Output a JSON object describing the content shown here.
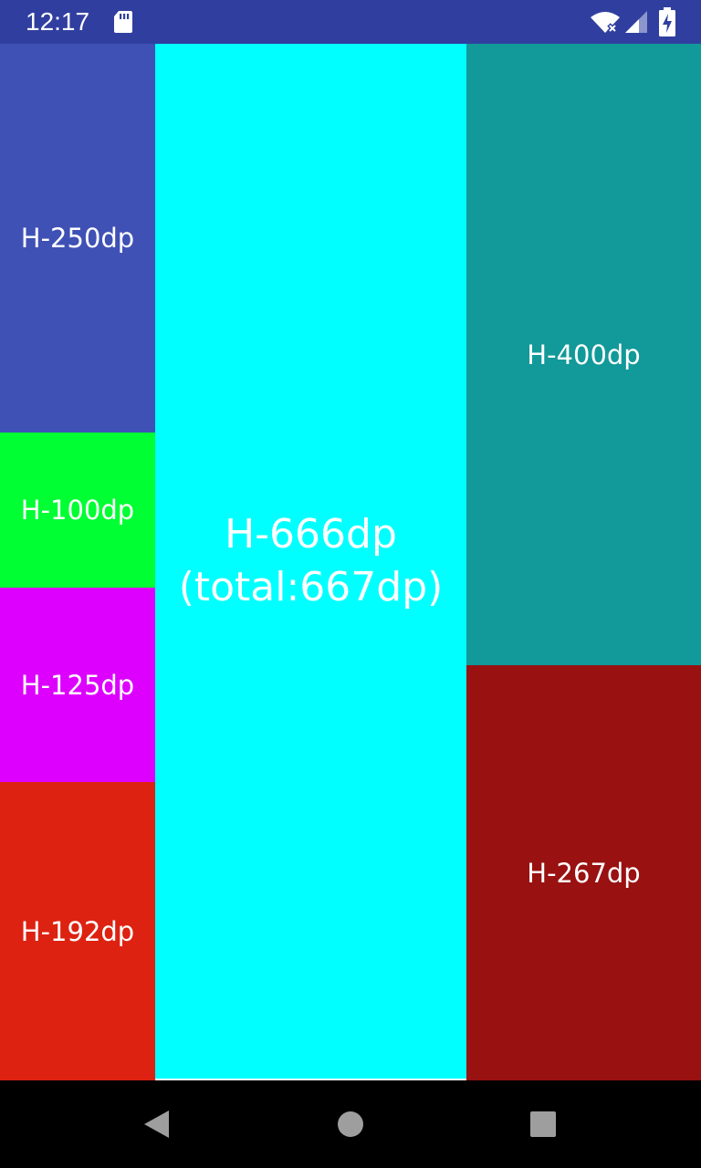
{
  "status_bar": {
    "time": "12:17",
    "background": "#303f9f",
    "icons": [
      "sd-card-icon",
      "wifi-icon",
      "cell-signal-icon",
      "battery-charging-icon"
    ]
  },
  "columns": {
    "left": [
      {
        "label": "H-250dp",
        "color": "#3f51b5"
      },
      {
        "label": "H-100dp",
        "color": "#00ff33"
      },
      {
        "label": "H-125dp",
        "color": "#dd00ff"
      },
      {
        "label": "H-192dp",
        "color": "#dd2211"
      }
    ],
    "center": [
      {
        "label": "H-666dp\n(total:667dp)",
        "color": "#00ffff"
      }
    ],
    "right": [
      {
        "label": "H-400dp",
        "color": "#129999"
      },
      {
        "label": "H-267dp",
        "color": "#991111"
      }
    ]
  },
  "nav_bar": {
    "buttons": [
      "back-icon",
      "home-icon",
      "recents-icon"
    ],
    "icon_color": "#9e9e9e"
  }
}
